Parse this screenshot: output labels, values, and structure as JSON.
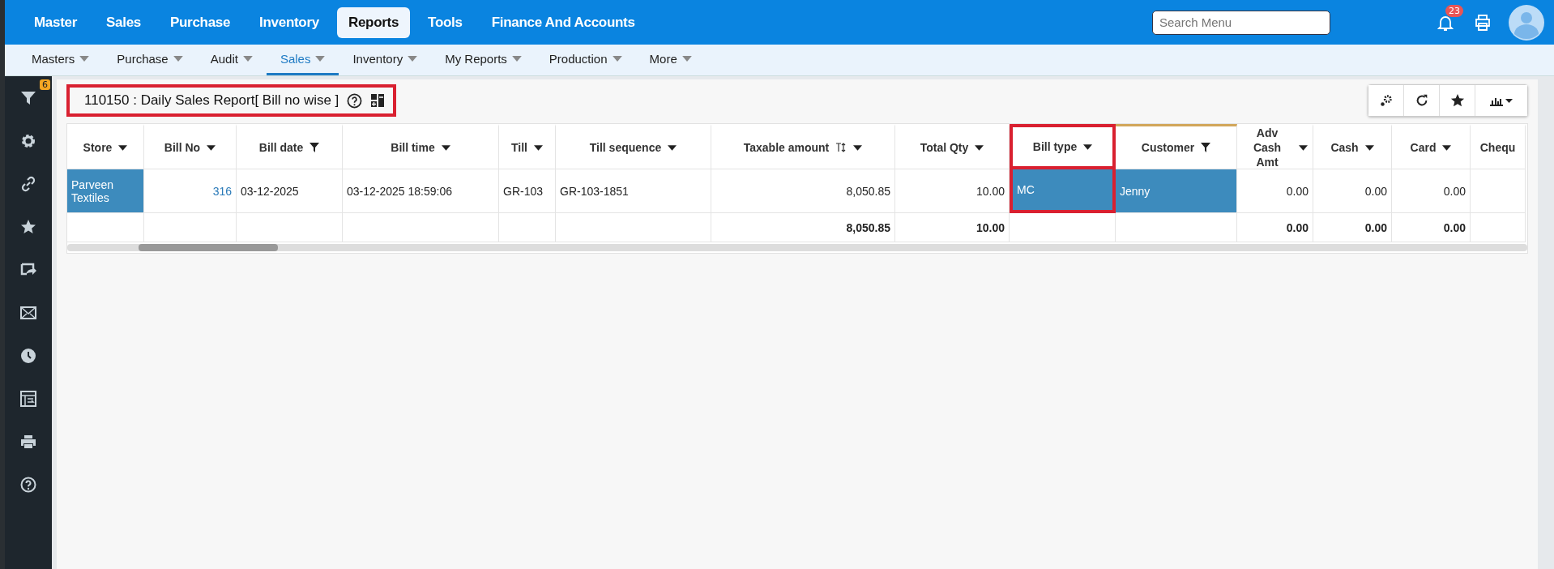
{
  "top_menu": [
    {
      "label": "Master",
      "selected": false
    },
    {
      "label": "Sales",
      "selected": false
    },
    {
      "label": "Purchase",
      "selected": false
    },
    {
      "label": "Inventory",
      "selected": false
    },
    {
      "label": "Reports",
      "selected": true
    },
    {
      "label": "Tools",
      "selected": false
    },
    {
      "label": "Finance And Accounts",
      "selected": false
    }
  ],
  "search": {
    "placeholder": "Search Menu"
  },
  "notifications": {
    "count": "23"
  },
  "sub_menu": [
    {
      "label": "Masters",
      "selected": false
    },
    {
      "label": "Purchase",
      "selected": false
    },
    {
      "label": "Audit",
      "selected": false
    },
    {
      "label": "Sales",
      "selected": true
    },
    {
      "label": "Inventory",
      "selected": false
    },
    {
      "label": "My Reports",
      "selected": false
    },
    {
      "label": "Production",
      "selected": false
    },
    {
      "label": "More",
      "selected": false
    }
  ],
  "sidebar": {
    "filter_count": "6",
    "items": [
      {
        "kind": "filter"
      },
      {
        "kind": "gear"
      },
      {
        "kind": "link"
      },
      {
        "kind": "star"
      },
      {
        "kind": "share"
      },
      {
        "kind": "mail"
      },
      {
        "kind": "clock"
      },
      {
        "kind": "table"
      },
      {
        "kind": "print"
      },
      {
        "kind": "help"
      }
    ]
  },
  "report": {
    "title": "110150 : Daily Sales Report[ Bill no wise ]",
    "highlighted": true
  },
  "table": {
    "columns": [
      {
        "label": "Store",
        "kind": "sort",
        "highlighted": false,
        "accent": false
      },
      {
        "label": "Bill No",
        "kind": "sort",
        "highlighted": false,
        "accent": false
      },
      {
        "label": "Bill date",
        "kind": "filter",
        "highlighted": false,
        "accent": false
      },
      {
        "label": "Bill time",
        "kind": "sort",
        "highlighted": false,
        "accent": false
      },
      {
        "label": "Till",
        "kind": "sort",
        "highlighted": false,
        "accent": false
      },
      {
        "label": "Till sequence",
        "kind": "sort",
        "highlighted": false,
        "accent": false
      },
      {
        "label": "Taxable amount",
        "kind": "sort-text",
        "highlighted": false,
        "accent": false,
        "total": "8,050.85"
      },
      {
        "label": "Total Qty",
        "kind": "sort",
        "highlighted": false,
        "accent": false,
        "total": "10.00"
      },
      {
        "label": "Bill type",
        "kind": "sort",
        "highlighted": true,
        "accent": false
      },
      {
        "label": "Customer",
        "kind": "filter",
        "highlighted": false,
        "accent": true
      },
      {
        "label": "Adv Cash Amt",
        "kind": "sort",
        "highlighted": false,
        "accent": false,
        "total": "0.00"
      },
      {
        "label": "Cash",
        "kind": "sort",
        "highlighted": false,
        "accent": false,
        "total": "0.00"
      },
      {
        "label": "Card",
        "kind": "sort",
        "highlighted": false,
        "accent": false,
        "total": "0.00"
      },
      {
        "label": "Chequ",
        "kind": "none",
        "highlighted": false,
        "accent": false
      }
    ],
    "rows": [
      [
        {
          "text": "Parveen Textiles",
          "selected": true
        },
        {
          "text": "316",
          "selected": false
        },
        {
          "text": "03-12-2025",
          "selected": false
        },
        {
          "text": "03-12-2025 18:59:06",
          "selected": false
        },
        {
          "text": "GR-103",
          "selected": false
        },
        {
          "text": "GR-103-1851",
          "selected": false
        },
        {
          "text": "8,050.85",
          "selected": false
        },
        {
          "text": "10.00",
          "selected": false
        },
        {
          "text": "MC",
          "selected": true
        },
        {
          "text": "Jenny",
          "selected": true
        },
        {
          "text": "0.00",
          "selected": false
        },
        {
          "text": "0.00",
          "selected": false
        },
        {
          "text": "0.00",
          "selected": false
        }
      ]
    ]
  }
}
